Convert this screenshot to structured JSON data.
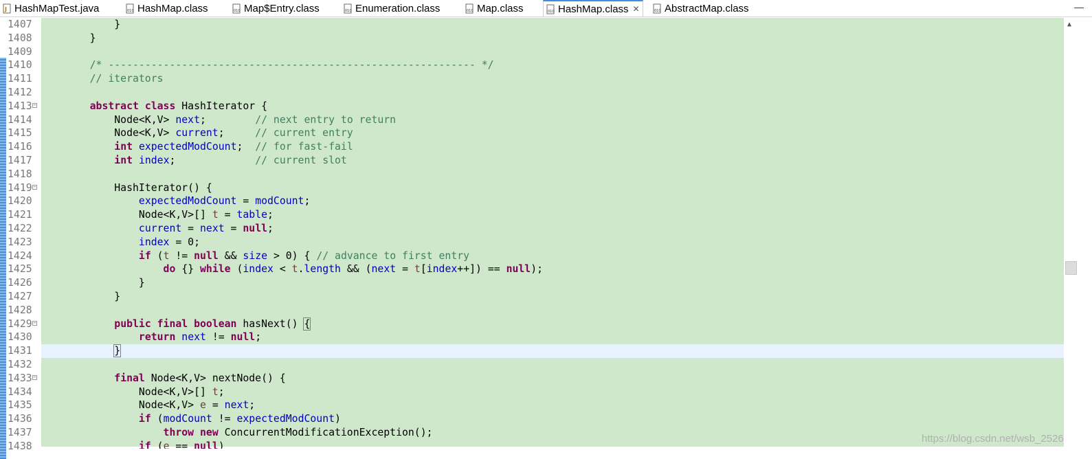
{
  "tabs": [
    {
      "label": "HashMapTest.java",
      "icon": "java-file-icon"
    },
    {
      "label": "HashMap.class",
      "icon": "class-file-icon"
    },
    {
      "label": "Map$Entry.class",
      "icon": "class-file-icon"
    },
    {
      "label": "Enumeration.class",
      "icon": "class-file-icon"
    },
    {
      "label": "Map.class",
      "icon": "class-file-icon"
    },
    {
      "label": "HashMap.class",
      "icon": "class-file-icon",
      "active": true,
      "close": "✕"
    },
    {
      "label": "AbstractMap.class",
      "icon": "class-file-icon"
    }
  ],
  "window": {
    "minimize": "—"
  },
  "editor": {
    "lines": [
      {
        "n": "1407",
        "fold": false
      },
      {
        "n": "1408",
        "fold": false
      },
      {
        "n": "1409",
        "fold": false
      },
      {
        "n": "1410",
        "fold": false
      },
      {
        "n": "1411",
        "fold": false
      },
      {
        "n": "1412",
        "fold": false
      },
      {
        "n": "1413",
        "fold": true
      },
      {
        "n": "1414",
        "fold": false
      },
      {
        "n": "1415",
        "fold": false
      },
      {
        "n": "1416",
        "fold": false
      },
      {
        "n": "1417",
        "fold": false
      },
      {
        "n": "1418",
        "fold": false
      },
      {
        "n": "1419",
        "fold": true
      },
      {
        "n": "1420",
        "fold": false
      },
      {
        "n": "1421",
        "fold": false
      },
      {
        "n": "1422",
        "fold": false
      },
      {
        "n": "1423",
        "fold": false
      },
      {
        "n": "1424",
        "fold": false
      },
      {
        "n": "1425",
        "fold": false
      },
      {
        "n": "1426",
        "fold": false
      },
      {
        "n": "1427",
        "fold": false
      },
      {
        "n": "1428",
        "fold": false
      },
      {
        "n": "1429",
        "fold": true
      },
      {
        "n": "1430",
        "fold": false
      },
      {
        "n": "1431",
        "fold": false,
        "current": true
      },
      {
        "n": "1432",
        "fold": false
      },
      {
        "n": "1433",
        "fold": true
      },
      {
        "n": "1434",
        "fold": false
      },
      {
        "n": "1435",
        "fold": false
      },
      {
        "n": "1436",
        "fold": false
      },
      {
        "n": "1437",
        "fold": false
      },
      {
        "n": "1438",
        "fold": false
      }
    ],
    "fold_glyph": "⊖",
    "code": [
      [
        [
          "",
          "        }"
        ]
      ],
      [
        [
          "",
          "    }"
        ]
      ],
      [
        [
          "",
          ""
        ]
      ],
      [
        [
          "cm",
          "    /* ------------------------------------------------------------ */"
        ]
      ],
      [
        [
          "cm",
          "    // iterators"
        ]
      ],
      [
        [
          "",
          ""
        ]
      ],
      [
        [
          "",
          "    "
        ],
        [
          "kw",
          "abstract class"
        ],
        [
          "",
          " HashIterator {"
        ]
      ],
      [
        [
          "",
          "        Node<K,V> "
        ],
        [
          "fd",
          "next"
        ],
        [
          "",
          ";        "
        ],
        [
          "cm",
          "// next entry to return"
        ]
      ],
      [
        [
          "",
          "        Node<K,V> "
        ],
        [
          "fd",
          "current"
        ],
        [
          "",
          ";     "
        ],
        [
          "cm",
          "// current entry"
        ]
      ],
      [
        [
          "",
          "        "
        ],
        [
          "kw",
          "int"
        ],
        [
          "",
          " "
        ],
        [
          "fd",
          "expectedModCount"
        ],
        [
          "",
          ";  "
        ],
        [
          "cm",
          "// for fast-fail"
        ]
      ],
      [
        [
          "",
          "        "
        ],
        [
          "kw",
          "int"
        ],
        [
          "",
          " "
        ],
        [
          "fd",
          "index"
        ],
        [
          "",
          ";             "
        ],
        [
          "cm",
          "// current slot"
        ]
      ],
      [
        [
          "",
          ""
        ]
      ],
      [
        [
          "",
          "        HashIterator() {"
        ]
      ],
      [
        [
          "",
          "            "
        ],
        [
          "fd",
          "expectedModCount"
        ],
        [
          "",
          " = "
        ],
        [
          "fd",
          "modCount"
        ],
        [
          "",
          ";"
        ]
      ],
      [
        [
          "",
          "            Node<K,V>[] "
        ],
        [
          "lv",
          "t"
        ],
        [
          "",
          " = "
        ],
        [
          "fd",
          "table"
        ],
        [
          "",
          ";"
        ]
      ],
      [
        [
          "",
          "            "
        ],
        [
          "fd",
          "current"
        ],
        [
          "",
          " = "
        ],
        [
          "fd",
          "next"
        ],
        [
          "",
          " = "
        ],
        [
          "kw",
          "null"
        ],
        [
          "",
          ";"
        ]
      ],
      [
        [
          "",
          "            "
        ],
        [
          "fd",
          "index"
        ],
        [
          "",
          " = 0;"
        ]
      ],
      [
        [
          "",
          "            "
        ],
        [
          "kw",
          "if"
        ],
        [
          "",
          " ("
        ],
        [
          "lv",
          "t"
        ],
        [
          "",
          " != "
        ],
        [
          "kw",
          "null"
        ],
        [
          "",
          " && "
        ],
        [
          "fd",
          "size"
        ],
        [
          "",
          " > 0) { "
        ],
        [
          "cm",
          "// advance to first entry"
        ]
      ],
      [
        [
          "",
          "                "
        ],
        [
          "kw",
          "do"
        ],
        [
          "",
          " {} "
        ],
        [
          "kw",
          "while"
        ],
        [
          "",
          " ("
        ],
        [
          "fd",
          "index"
        ],
        [
          "",
          " < "
        ],
        [
          "lv",
          "t"
        ],
        [
          "",
          "."
        ],
        [
          "fd",
          "length"
        ],
        [
          "",
          " && ("
        ],
        [
          "fd",
          "next"
        ],
        [
          "",
          " = "
        ],
        [
          "lv",
          "t"
        ],
        [
          "",
          "["
        ],
        [
          "fd",
          "index"
        ],
        [
          "",
          "++]) == "
        ],
        [
          "kw",
          "null"
        ],
        [
          "",
          ");"
        ]
      ],
      [
        [
          "",
          "            }"
        ]
      ],
      [
        [
          "",
          "        }"
        ]
      ],
      [
        [
          "",
          ""
        ]
      ],
      [
        [
          "",
          "        "
        ],
        [
          "kw",
          "public final boolean"
        ],
        [
          "",
          " hasNext() "
        ],
        [
          "box",
          "{"
        ]
      ],
      [
        [
          "",
          "            "
        ],
        [
          "kw",
          "return"
        ],
        [
          "",
          " "
        ],
        [
          "fd",
          "next"
        ],
        [
          "",
          " != "
        ],
        [
          "kw",
          "null"
        ],
        [
          "",
          ";"
        ]
      ],
      [
        [
          "",
          "        "
        ],
        [
          "box",
          "}"
        ],
        [
          "cursor",
          ""
        ]
      ],
      [
        [
          "",
          ""
        ]
      ],
      [
        [
          "",
          "        "
        ],
        [
          "kw",
          "final"
        ],
        [
          "",
          " Node<K,V> nextNode() {"
        ]
      ],
      [
        [
          "",
          "            Node<K,V>[] "
        ],
        [
          "lv",
          "t"
        ],
        [
          "",
          ";"
        ]
      ],
      [
        [
          "",
          "            Node<K,V> "
        ],
        [
          "lv",
          "e"
        ],
        [
          "",
          " = "
        ],
        [
          "fd",
          "next"
        ],
        [
          "",
          ";"
        ]
      ],
      [
        [
          "",
          "            "
        ],
        [
          "kw",
          "if"
        ],
        [
          "",
          " ("
        ],
        [
          "fd",
          "modCount"
        ],
        [
          "",
          " != "
        ],
        [
          "fd",
          "expectedModCount"
        ],
        [
          "",
          ")"
        ]
      ],
      [
        [
          "",
          "                "
        ],
        [
          "kw",
          "throw new"
        ],
        [
          "",
          " ConcurrentModificationException();"
        ]
      ],
      [
        [
          "",
          "            "
        ],
        [
          "kw",
          "if"
        ],
        [
          "",
          " ("
        ],
        [
          "lv",
          "e"
        ],
        [
          "",
          " == "
        ],
        [
          "kw",
          "null"
        ],
        [
          "",
          ")"
        ]
      ]
    ]
  },
  "watermark": "https://blog.csdn.net/wsb_2526",
  "colors": {
    "editor_bg": "#cfe8cc",
    "current_line": "#e8f2fe",
    "keyword": "#7f0055",
    "comment": "#3f7f5f",
    "field": "#0000c0",
    "local": "#6a3e3e"
  }
}
